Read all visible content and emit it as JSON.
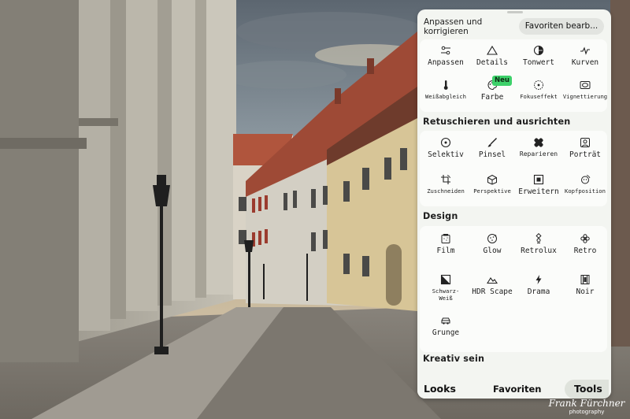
{
  "panel": {
    "header": {
      "title": "Anpassen und korrigieren",
      "favorites_button": "Favoriten bearb..."
    },
    "sections": {
      "adjust": {
        "tools": [
          {
            "label": "Anpassen",
            "icon": "sliders-icon"
          },
          {
            "label": "Details",
            "icon": "triangle-icon"
          },
          {
            "label": "Tonwert",
            "icon": "tonal-contrast-icon"
          },
          {
            "label": "Kurven",
            "icon": "curves-icon"
          },
          {
            "label": "Weißabgleich",
            "icon": "thermometer-icon"
          },
          {
            "label": "Farbe",
            "icon": "palette-icon",
            "badge": "Neu"
          },
          {
            "label": "Fokuseffekt",
            "icon": "lens-blur-icon"
          },
          {
            "label": "Vignettierung",
            "icon": "vignette-icon"
          }
        ]
      },
      "retouch": {
        "title": "Retuschieren und ausrichten",
        "tools": [
          {
            "label": "Selektiv",
            "icon": "selective-icon"
          },
          {
            "label": "Pinsel",
            "icon": "brush-icon"
          },
          {
            "label": "Reparieren",
            "icon": "bandage-icon"
          },
          {
            "label": "Porträt",
            "icon": "portrait-icon"
          },
          {
            "label": "Zuschneiden",
            "icon": "crop-rotate-icon"
          },
          {
            "label": "Perspektive",
            "icon": "perspective-cube-icon"
          },
          {
            "label": "Erweitern",
            "icon": "expand-icon"
          },
          {
            "label": "Kopfposition",
            "icon": "head-pose-icon"
          }
        ]
      },
      "design": {
        "title": "Design",
        "tools": [
          {
            "label": "Film",
            "icon": "film-icon"
          },
          {
            "label": "Glow",
            "icon": "glow-icon"
          },
          {
            "label": "Retrolux",
            "icon": "retrolux-icon"
          },
          {
            "label": "Retro",
            "icon": "retro-flower-icon"
          },
          {
            "label": "Schwarz-Weiß",
            "icon": "black-white-icon"
          },
          {
            "label": "HDR Scape",
            "icon": "mountains-icon"
          },
          {
            "label": "Drama",
            "icon": "lightning-icon"
          },
          {
            "label": "Noir",
            "icon": "film-strip-icon"
          },
          {
            "label": "Grunge",
            "icon": "grunge-car-icon"
          }
        ]
      },
      "creative": {
        "title": "Kreativ sein"
      }
    },
    "tabs": {
      "looks": "Looks",
      "favorites": "Favoriten",
      "tools": "Tools",
      "active": "Tools"
    }
  },
  "watermark": {
    "name": "Frank Fürchner",
    "subtitle": "photography"
  },
  "colors": {
    "panel_bg": "#f3f5f1",
    "card_bg": "#fbfcfa",
    "badge_bg": "#3dd16a",
    "active_tab_bg": "#dfe3dc"
  }
}
